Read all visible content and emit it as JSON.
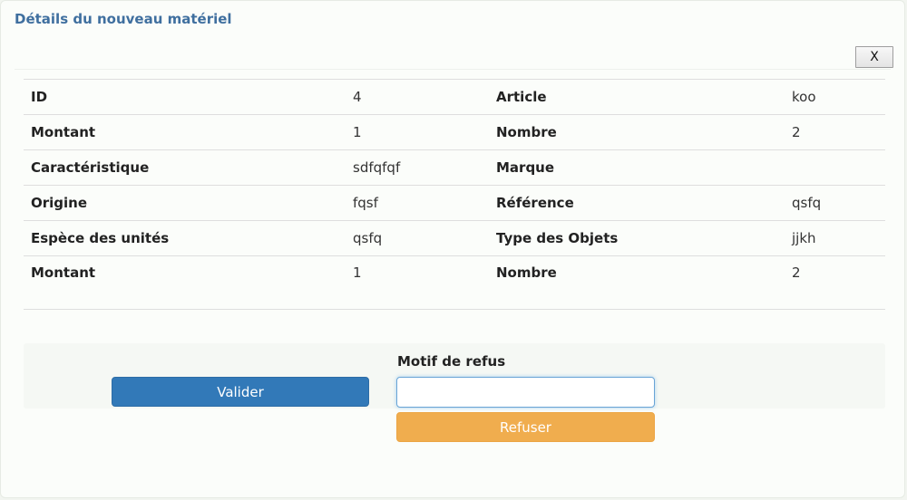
{
  "modal": {
    "title": "Détails du nouveau matériel",
    "close_label": "X"
  },
  "details": {
    "rows": [
      {
        "label1": "ID",
        "value1": "4",
        "label2": "Article",
        "value2": "koo"
      },
      {
        "label1": "Montant",
        "value1": "1",
        "label2": "Nombre",
        "value2": "2"
      },
      {
        "label1": "Caractéristique",
        "value1": "sdfqfqf",
        "label2": "Marque",
        "value2": ""
      },
      {
        "label1": "Origine",
        "value1": "fqsf",
        "label2": "Référence",
        "value2": "qsfq"
      },
      {
        "label1": "Espèce des unités",
        "value1": "qsfq",
        "label2": "Type des Objets",
        "value2": "jjkh"
      },
      {
        "label1": "Montant",
        "value1": "1",
        "label2": "Nombre",
        "value2": "2"
      }
    ]
  },
  "actions": {
    "valider_label": "Valider",
    "motif_label": "Motif de refus",
    "motif_value": "",
    "refuser_label": "Refuser"
  },
  "colors": {
    "title": "#3f6f9f",
    "primary_button": "#3279b8",
    "warning_button": "#f0ad4e",
    "input_focus_border": "#69a4d6"
  }
}
